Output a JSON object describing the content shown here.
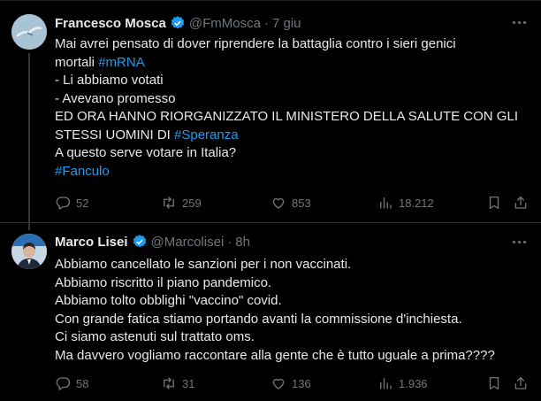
{
  "tweets": [
    {
      "name": "Francesco Mosca",
      "handle": "@FmMosca",
      "separator": "·",
      "time": "7 giu",
      "lines": [
        [
          {
            "t": "Mai avrei pensato di dover riprendere la battaglia contro i sieri genici"
          }
        ],
        [
          {
            "t": "mortali "
          },
          {
            "t": "#mRNA",
            "tag": true
          }
        ],
        [
          {
            "t": "- Li abbiamo votati"
          }
        ],
        [
          {
            "t": "- Avevano promesso"
          }
        ],
        [
          {
            "t": "ED ORA HANNO RIORGANIZZATO IL MINISTERO DELLA SALUTE CON GLI"
          }
        ],
        [
          {
            "t": "STESSI UOMINI DI "
          },
          {
            "t": "#Speranza",
            "tag": true
          }
        ],
        [
          {
            "t": "A questo serve votare in Italia?"
          }
        ],
        [
          {
            "t": "#Fanculo",
            "tag": true
          }
        ]
      ],
      "replies": "52",
      "retweets": "259",
      "likes": "853",
      "views": "18.212"
    },
    {
      "name": "Marco Lisei",
      "handle": "@Marcolisei",
      "separator": "·",
      "time": "8h",
      "lines": [
        [
          {
            "t": "Abbiamo cancellato le sanzioni per i non vaccinati."
          }
        ],
        [
          {
            "t": "Abbiamo riscritto il piano pandemico."
          }
        ],
        [
          {
            "t": "Abbiamo tolto obblighi \"vaccino\" covid."
          }
        ],
        [
          {
            "t": "Con grande fatica stiamo portando avanti la commissione d'inchiesta."
          }
        ],
        [
          {
            "t": "Ci siamo astenuti sul trattato oms."
          }
        ],
        [
          {
            "t": "Ma davvero vogliamo raccontare alla gente che è tutto uguale a prima????"
          }
        ]
      ],
      "replies": "58",
      "retweets": "31",
      "likes": "136",
      "views": "1.936"
    }
  ],
  "colors": {
    "background": "#000000",
    "text": "#e7e9ea",
    "muted": "#71767b",
    "hashtag": "#1d9bf0",
    "verified": "#1d9bf0"
  },
  "icons": [
    "verified-badge-icon",
    "more-icon",
    "reply-icon",
    "retweet-icon",
    "like-icon",
    "views-icon",
    "bookmark-icon",
    "share-icon"
  ]
}
